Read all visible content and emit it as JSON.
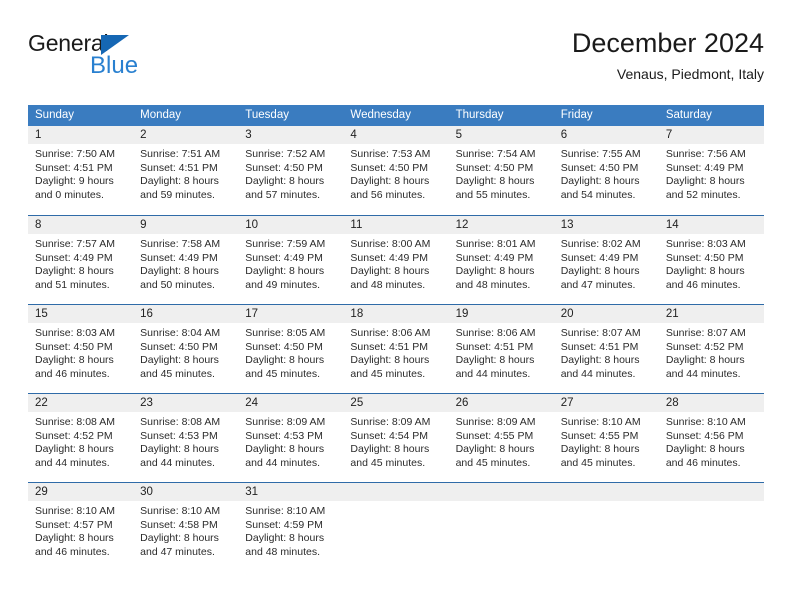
{
  "brand": {
    "word_general": "General",
    "word_blue": "Blue",
    "triangle_icon": "triangle-icon",
    "accent_blue": "#2980d0",
    "dark_blue": "#1567b4"
  },
  "header": {
    "title": "December 2024",
    "subtitle": "Venaus, Piedmont, Italy"
  },
  "theme": {
    "header_row_bg": "#3a7cc0",
    "week_divider": "#2f6ba8",
    "daynum_band_bg": "#efefef",
    "text": "#2b2b2b"
  },
  "weekdays": [
    "Sunday",
    "Monday",
    "Tuesday",
    "Wednesday",
    "Thursday",
    "Friday",
    "Saturday"
  ],
  "weeks": [
    [
      {
        "day": "1",
        "sunrise": "Sunrise: 7:50 AM",
        "sunset": "Sunset: 4:51 PM",
        "daylight1": "Daylight: 9 hours",
        "daylight2": "and 0 minutes."
      },
      {
        "day": "2",
        "sunrise": "Sunrise: 7:51 AM",
        "sunset": "Sunset: 4:51 PM",
        "daylight1": "Daylight: 8 hours",
        "daylight2": "and 59 minutes."
      },
      {
        "day": "3",
        "sunrise": "Sunrise: 7:52 AM",
        "sunset": "Sunset: 4:50 PM",
        "daylight1": "Daylight: 8 hours",
        "daylight2": "and 57 minutes."
      },
      {
        "day": "4",
        "sunrise": "Sunrise: 7:53 AM",
        "sunset": "Sunset: 4:50 PM",
        "daylight1": "Daylight: 8 hours",
        "daylight2": "and 56 minutes."
      },
      {
        "day": "5",
        "sunrise": "Sunrise: 7:54 AM",
        "sunset": "Sunset: 4:50 PM",
        "daylight1": "Daylight: 8 hours",
        "daylight2": "and 55 minutes."
      },
      {
        "day": "6",
        "sunrise": "Sunrise: 7:55 AM",
        "sunset": "Sunset: 4:50 PM",
        "daylight1": "Daylight: 8 hours",
        "daylight2": "and 54 minutes."
      },
      {
        "day": "7",
        "sunrise": "Sunrise: 7:56 AM",
        "sunset": "Sunset: 4:49 PM",
        "daylight1": "Daylight: 8 hours",
        "daylight2": "and 52 minutes."
      }
    ],
    [
      {
        "day": "8",
        "sunrise": "Sunrise: 7:57 AM",
        "sunset": "Sunset: 4:49 PM",
        "daylight1": "Daylight: 8 hours",
        "daylight2": "and 51 minutes."
      },
      {
        "day": "9",
        "sunrise": "Sunrise: 7:58 AM",
        "sunset": "Sunset: 4:49 PM",
        "daylight1": "Daylight: 8 hours",
        "daylight2": "and 50 minutes."
      },
      {
        "day": "10",
        "sunrise": "Sunrise: 7:59 AM",
        "sunset": "Sunset: 4:49 PM",
        "daylight1": "Daylight: 8 hours",
        "daylight2": "and 49 minutes."
      },
      {
        "day": "11",
        "sunrise": "Sunrise: 8:00 AM",
        "sunset": "Sunset: 4:49 PM",
        "daylight1": "Daylight: 8 hours",
        "daylight2": "and 48 minutes."
      },
      {
        "day": "12",
        "sunrise": "Sunrise: 8:01 AM",
        "sunset": "Sunset: 4:49 PM",
        "daylight1": "Daylight: 8 hours",
        "daylight2": "and 48 minutes."
      },
      {
        "day": "13",
        "sunrise": "Sunrise: 8:02 AM",
        "sunset": "Sunset: 4:49 PM",
        "daylight1": "Daylight: 8 hours",
        "daylight2": "and 47 minutes."
      },
      {
        "day": "14",
        "sunrise": "Sunrise: 8:03 AM",
        "sunset": "Sunset: 4:50 PM",
        "daylight1": "Daylight: 8 hours",
        "daylight2": "and 46 minutes."
      }
    ],
    [
      {
        "day": "15",
        "sunrise": "Sunrise: 8:03 AM",
        "sunset": "Sunset: 4:50 PM",
        "daylight1": "Daylight: 8 hours",
        "daylight2": "and 46 minutes."
      },
      {
        "day": "16",
        "sunrise": "Sunrise: 8:04 AM",
        "sunset": "Sunset: 4:50 PM",
        "daylight1": "Daylight: 8 hours",
        "daylight2": "and 45 minutes."
      },
      {
        "day": "17",
        "sunrise": "Sunrise: 8:05 AM",
        "sunset": "Sunset: 4:50 PM",
        "daylight1": "Daylight: 8 hours",
        "daylight2": "and 45 minutes."
      },
      {
        "day": "18",
        "sunrise": "Sunrise: 8:06 AM",
        "sunset": "Sunset: 4:51 PM",
        "daylight1": "Daylight: 8 hours",
        "daylight2": "and 45 minutes."
      },
      {
        "day": "19",
        "sunrise": "Sunrise: 8:06 AM",
        "sunset": "Sunset: 4:51 PM",
        "daylight1": "Daylight: 8 hours",
        "daylight2": "and 44 minutes."
      },
      {
        "day": "20",
        "sunrise": "Sunrise: 8:07 AM",
        "sunset": "Sunset: 4:51 PM",
        "daylight1": "Daylight: 8 hours",
        "daylight2": "and 44 minutes."
      },
      {
        "day": "21",
        "sunrise": "Sunrise: 8:07 AM",
        "sunset": "Sunset: 4:52 PM",
        "daylight1": "Daylight: 8 hours",
        "daylight2": "and 44 minutes."
      }
    ],
    [
      {
        "day": "22",
        "sunrise": "Sunrise: 8:08 AM",
        "sunset": "Sunset: 4:52 PM",
        "daylight1": "Daylight: 8 hours",
        "daylight2": "and 44 minutes."
      },
      {
        "day": "23",
        "sunrise": "Sunrise: 8:08 AM",
        "sunset": "Sunset: 4:53 PM",
        "daylight1": "Daylight: 8 hours",
        "daylight2": "and 44 minutes."
      },
      {
        "day": "24",
        "sunrise": "Sunrise: 8:09 AM",
        "sunset": "Sunset: 4:53 PM",
        "daylight1": "Daylight: 8 hours",
        "daylight2": "and 44 minutes."
      },
      {
        "day": "25",
        "sunrise": "Sunrise: 8:09 AM",
        "sunset": "Sunset: 4:54 PM",
        "daylight1": "Daylight: 8 hours",
        "daylight2": "and 45 minutes."
      },
      {
        "day": "26",
        "sunrise": "Sunrise: 8:09 AM",
        "sunset": "Sunset: 4:55 PM",
        "daylight1": "Daylight: 8 hours",
        "daylight2": "and 45 minutes."
      },
      {
        "day": "27",
        "sunrise": "Sunrise: 8:10 AM",
        "sunset": "Sunset: 4:55 PM",
        "daylight1": "Daylight: 8 hours",
        "daylight2": "and 45 minutes."
      },
      {
        "day": "28",
        "sunrise": "Sunrise: 8:10 AM",
        "sunset": "Sunset: 4:56 PM",
        "daylight1": "Daylight: 8 hours",
        "daylight2": "and 46 minutes."
      }
    ],
    [
      {
        "day": "29",
        "sunrise": "Sunrise: 8:10 AM",
        "sunset": "Sunset: 4:57 PM",
        "daylight1": "Daylight: 8 hours",
        "daylight2": "and 46 minutes."
      },
      {
        "day": "30",
        "sunrise": "Sunrise: 8:10 AM",
        "sunset": "Sunset: 4:58 PM",
        "daylight1": "Daylight: 8 hours",
        "daylight2": "and 47 minutes."
      },
      {
        "day": "31",
        "sunrise": "Sunrise: 8:10 AM",
        "sunset": "Sunset: 4:59 PM",
        "daylight1": "Daylight: 8 hours",
        "daylight2": "and 48 minutes."
      },
      {
        "day": "",
        "sunrise": "",
        "sunset": "",
        "daylight1": "",
        "daylight2": ""
      },
      {
        "day": "",
        "sunrise": "",
        "sunset": "",
        "daylight1": "",
        "daylight2": ""
      },
      {
        "day": "",
        "sunrise": "",
        "sunset": "",
        "daylight1": "",
        "daylight2": ""
      },
      {
        "day": "",
        "sunrise": "",
        "sunset": "",
        "daylight1": "",
        "daylight2": ""
      }
    ]
  ]
}
